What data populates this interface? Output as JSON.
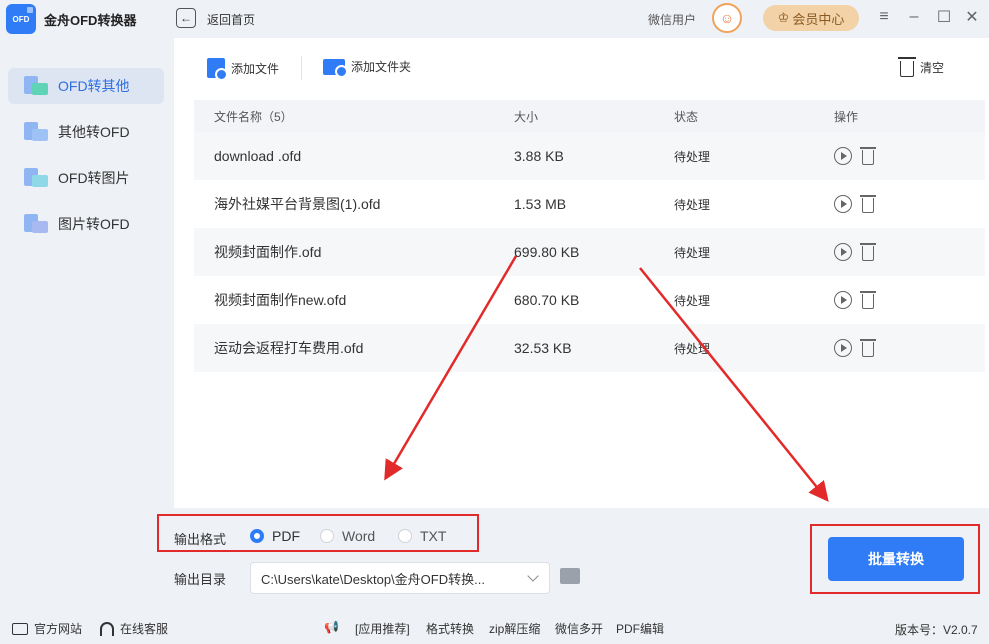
{
  "app": {
    "logo_text": "OFD",
    "title": "金舟OFD转换器"
  },
  "header": {
    "back_label": "返回首页",
    "user_name": "微信用户",
    "vip_label": "会员中心"
  },
  "sidebar": {
    "items": [
      {
        "label": "OFD转其他",
        "active": true
      },
      {
        "label": "其他转OFD",
        "active": false
      },
      {
        "label": "OFD转图片",
        "active": false
      },
      {
        "label": "图片转OFD",
        "active": false
      }
    ]
  },
  "toolbar": {
    "add_file": "添加文件",
    "add_folder": "添加文件夹",
    "clear": "清空"
  },
  "table": {
    "headers": {
      "name": "文件名称（5）",
      "size": "大小",
      "status": "状态",
      "op": "操作"
    },
    "rows": [
      {
        "name": "download .ofd",
        "size": "3.88 KB",
        "status": "待处理"
      },
      {
        "name": "海外社媒平台背景图(1).ofd",
        "size": "1.53 MB",
        "status": "待处理"
      },
      {
        "name": "视频封面制作.ofd",
        "size": "699.80 KB",
        "status": "待处理"
      },
      {
        "name": "视频封面制作new.ofd",
        "size": "680.70 KB",
        "status": "待处理"
      },
      {
        "name": "运动会返程打车费用.ofd",
        "size": "32.53 KB",
        "status": "待处理"
      }
    ]
  },
  "output": {
    "format_label": "输出格式",
    "formats": [
      {
        "label": "PDF",
        "selected": true
      },
      {
        "label": "Word",
        "selected": false
      },
      {
        "label": "TXT",
        "selected": false
      }
    ],
    "dir_label": "输出目录",
    "dir_value": "C:\\Users\\kate\\Desktop\\金舟OFD转换...",
    "convert_label": "批量转换"
  },
  "statusbar": {
    "website": "官方网站",
    "support": "在线客服",
    "recommend": "[应用推荐]",
    "links": [
      "格式转换",
      "zip解压缩",
      "微信多开",
      "PDF编辑"
    ],
    "version": "版本号：V2.0.7"
  },
  "colors": {
    "accent": "#2f7cf6",
    "highlight": "#e22a2a",
    "vip": "#f3d2a7"
  }
}
